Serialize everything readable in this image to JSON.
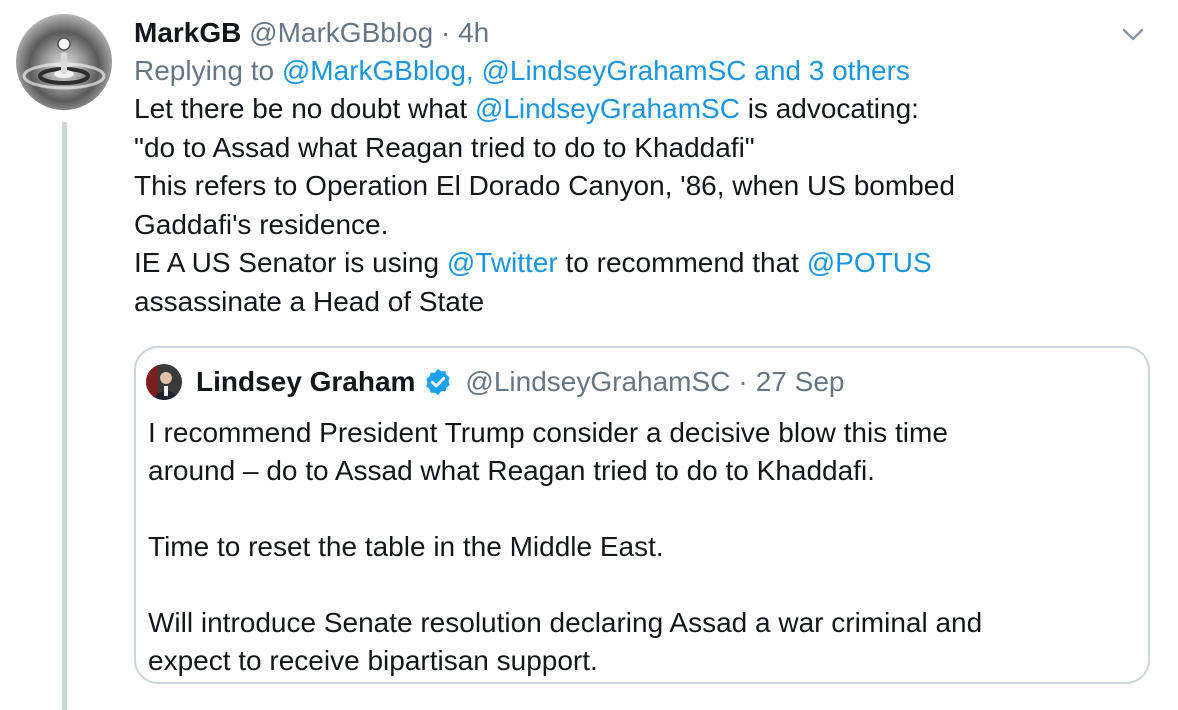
{
  "tweet": {
    "display_name": "MarkGB",
    "handle": "@MarkGBblog",
    "separator": "·",
    "time": "4h",
    "reply": {
      "prefix": "Replying to",
      "handle1": "@MarkGBblog,",
      "handle2": "@LindseyGrahamSC",
      "others": "and 3 others"
    },
    "body": {
      "l1_a": "Let there be no doubt what",
      "l1_mention": "@LindseyGrahamSC",
      "l1_b": "is advocating:",
      "l2": "\"do to Assad what Reagan tried to do to Khaddafi\"",
      "l3": "This refers to Operation El Dorado Canyon, '86, when US bombed",
      "l4": "Gaddafi's residence.",
      "l5_a": "IE A US Senator is using",
      "l5_mention1": "@Twitter",
      "l5_b": "to recommend that",
      "l5_mention2": "@POTUS",
      "l6": "assassinate a Head of State"
    },
    "colors": {
      "link": "#1b95e0",
      "muted": "#657786",
      "border": "#ccd6dd",
      "verified": "#1da1f2"
    },
    "icons": {
      "menu": "chevron-down-icon",
      "verified": "verified-badge-icon"
    }
  },
  "quote": {
    "display_name": "Lindsey Graham",
    "handle": "@LindseyGrahamSC",
    "separator": "·",
    "date": "27 Sep",
    "p1_l1": "I recommend President Trump consider a decisive blow this time",
    "p1_l2": "around – do to Assad what Reagan tried to do to Khaddafi.",
    "p2": "Time to reset the table in the Middle East.",
    "p3_l1": "Will introduce Senate resolution declaring Assad a war criminal and",
    "p3_l2": "expect to receive bipartisan support."
  }
}
